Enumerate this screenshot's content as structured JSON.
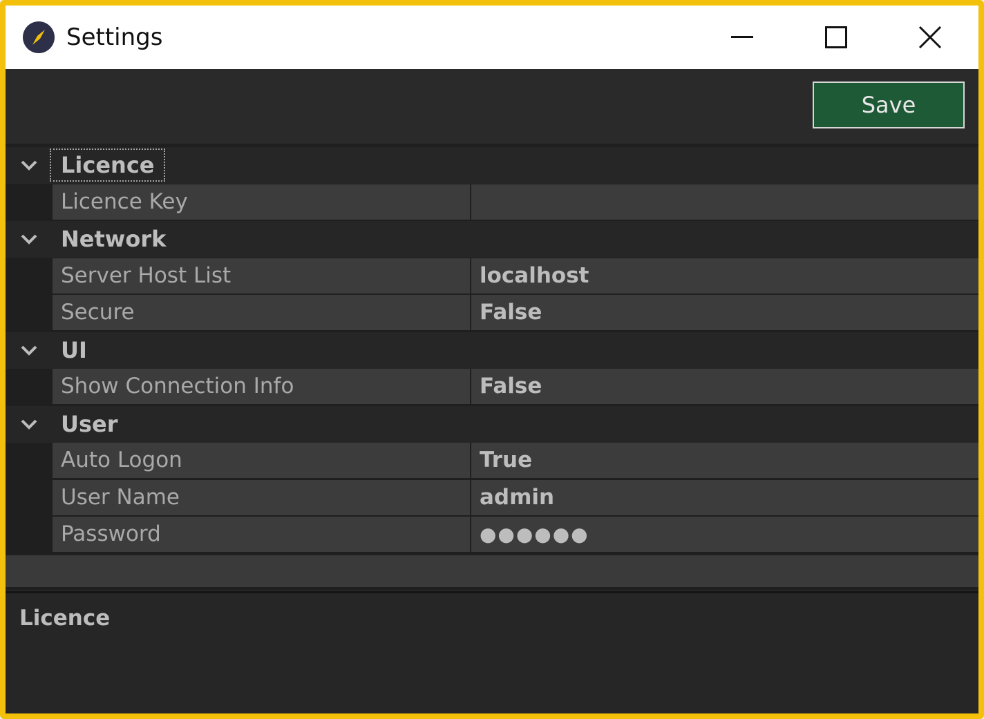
{
  "window": {
    "title": "Settings",
    "icon": "compass-icon",
    "accent": "#f3c10b"
  },
  "toolbar": {
    "save_label": "Save",
    "save_color": "#1f5a37"
  },
  "grid": {
    "categories": [
      {
        "label": "Licence",
        "expanded": true,
        "properties": [
          {
            "name": "Licence Key",
            "value": ""
          }
        ]
      },
      {
        "label": "Network",
        "expanded": true,
        "properties": [
          {
            "name": "Server Host List",
            "value": "localhost"
          },
          {
            "name": "Secure",
            "value": "False"
          }
        ]
      },
      {
        "label": "UI",
        "expanded": true,
        "properties": [
          {
            "name": "Show Connection Info",
            "value": "False"
          }
        ]
      },
      {
        "label": "User",
        "expanded": true,
        "properties": [
          {
            "name": "Auto Logon",
            "value": "True"
          },
          {
            "name": "User Name",
            "value": "admin"
          },
          {
            "name": "Password",
            "value": "●●●●●●"
          }
        ]
      }
    ]
  },
  "description": {
    "title": "Licence"
  }
}
